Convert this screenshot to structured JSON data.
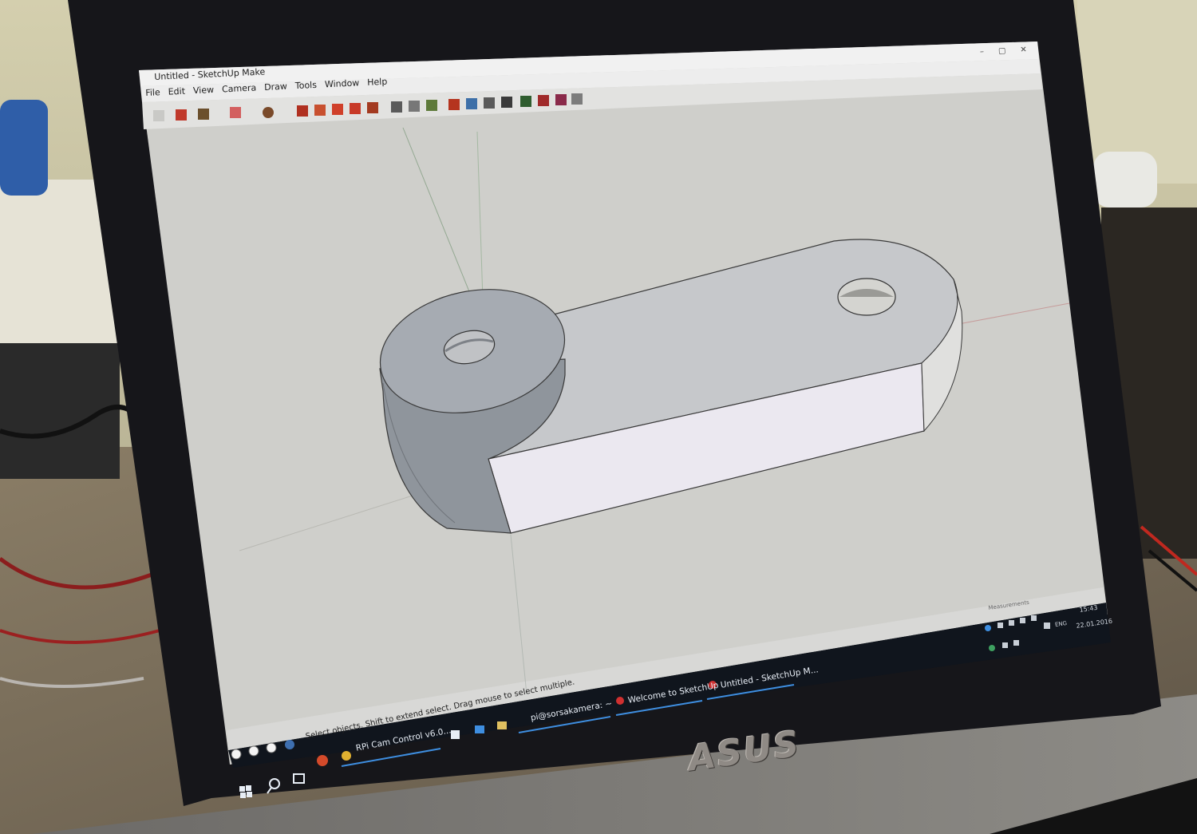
{
  "window": {
    "title": "Untitled - SketchUp Make",
    "controls": [
      "–",
      "▢",
      "✕"
    ]
  },
  "menu": [
    "File",
    "Edit",
    "View",
    "Camera",
    "Draw",
    "Tools",
    "Window",
    "Help"
  ],
  "status_bar": {
    "hint": "Select objects. Shift to extend select. Drag mouse to select multiple.",
    "measurements_label": "Measurements"
  },
  "taskbar": {
    "items": [
      {
        "label": "RPi Cam Control v6.0..."
      },
      {
        "label": "pi@sorsakamera: ~"
      },
      {
        "label": "Welcome to SketchUp"
      },
      {
        "label": "Untitled - SketchUp M..."
      }
    ],
    "language": "ENG",
    "time": "15:43",
    "date": "22.01.2016"
  },
  "laptop_brand": "ASUS",
  "colors": {
    "viewport": "#cfcfcb",
    "taskbar": "#10151d",
    "model_top": "#c6c8cb",
    "model_side_light": "#ebe8f0",
    "cylinder": "#8f959c",
    "accent": "#3e8ee0"
  }
}
